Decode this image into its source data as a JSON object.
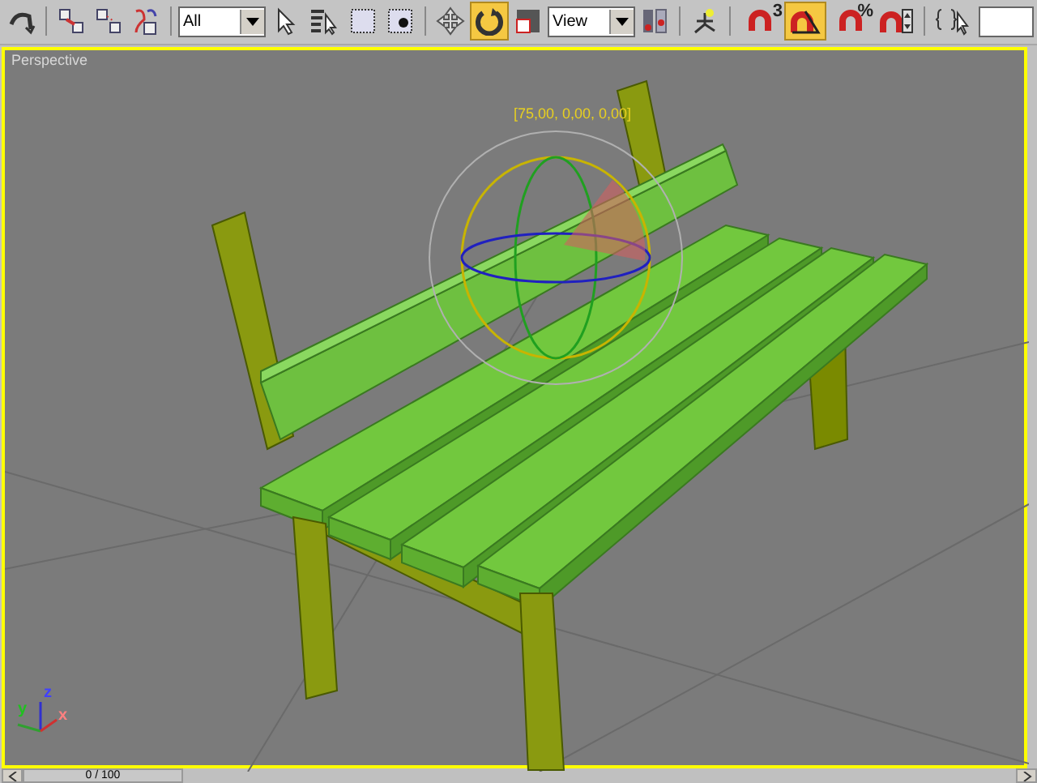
{
  "toolbar": {
    "selection_filter": "All",
    "reference_coordinate_system": "View",
    "rotate_active": true,
    "angle_snap_active": true,
    "snaps_toggle_label": "3",
    "percent_snap_label": "%"
  },
  "viewport": {
    "label": "Perspective",
    "active": true,
    "gizmo_readout": "[75,00, 0,00, 0,00]",
    "axes": [
      {
        "label": "z",
        "color": "#4040ff"
      },
      {
        "label": "y",
        "color": "#20c020"
      },
      {
        "label": "x",
        "color": "#ff8080"
      }
    ]
  },
  "time_slider": {
    "label": "0 / 100",
    "level": 0
  }
}
